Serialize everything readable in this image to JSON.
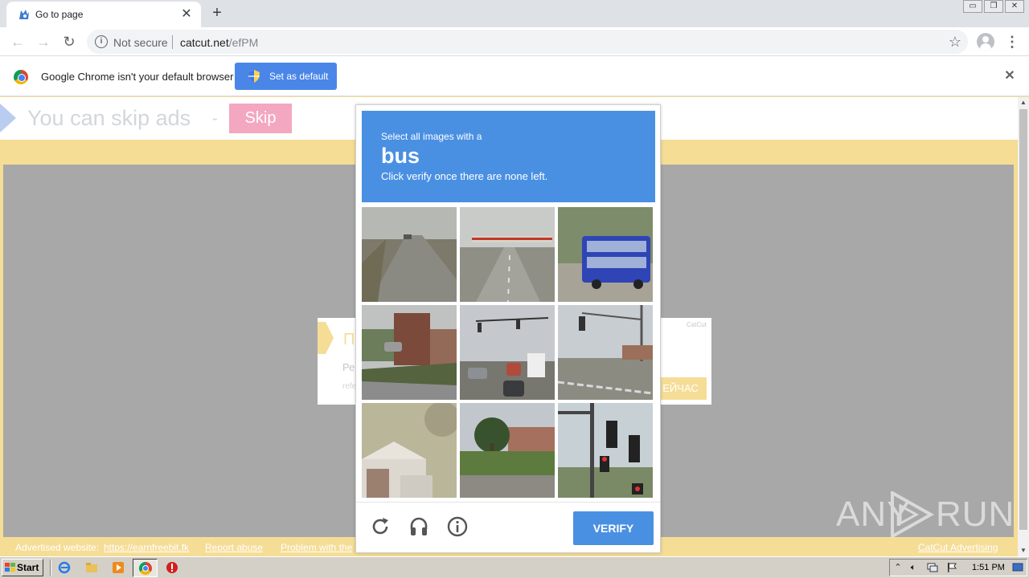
{
  "browser": {
    "tab": {
      "title": "Go to page",
      "close": "✕"
    },
    "new_tab": "+",
    "window_buttons": {
      "minimize": "▭",
      "restore": "❐",
      "close": "✕"
    },
    "nav": {
      "back": "←",
      "forward": "→",
      "reload": "↻"
    },
    "omnibox": {
      "info": "i",
      "security": "Not secure",
      "domain": "catcut.net",
      "path": "/efPM",
      "bookmark": "☆"
    },
    "menu": "⋮",
    "infobar": {
      "message": "Google Chrome isn't your default browser",
      "button": "Set as default",
      "close": "✕"
    }
  },
  "page": {
    "skip_text": "You can skip ads",
    "skip_dash": "-",
    "skip_button": "Skip",
    "promo": {
      "title": "П",
      "subtitle": "Ре",
      "small": "refe",
      "brand": "CatCut",
      "button": "ЕЙЧАС"
    },
    "footer": {
      "advertised_label": "Advertised website:",
      "advertised_link": "https://earnfreebit.fk",
      "report": "Report abuse",
      "problem": "Problem with the",
      "brand": "CatCut Advertising"
    },
    "colors": {
      "background": "#f5dd96",
      "skip_button": "#f4a7c0",
      "gray_area": "#a8a8a8"
    }
  },
  "scrollbar": {
    "up": "▲",
    "down": "▼"
  },
  "captcha": {
    "instruction": "Select all images with a",
    "target": "bus",
    "hint": "Click verify once there are none left.",
    "verify": "VERIFY",
    "tiles": [
      "highway-road",
      "highway-overpass",
      "blue-double-decker-bus",
      "street-buildings-cars",
      "traffic-intersection-trucks",
      "intersection-traffic-light",
      "house-garage",
      "trees-lawn",
      "traffic-signal-close"
    ],
    "icons": [
      "reload-icon",
      "audio-icon",
      "info-icon"
    ],
    "colors": {
      "header": "#4a90e2",
      "verify": "#4a90e2"
    }
  },
  "watermark": {
    "left": "ANY",
    "right": "RUN"
  },
  "taskbar": {
    "start": "Start",
    "clock": "1:51 PM"
  }
}
